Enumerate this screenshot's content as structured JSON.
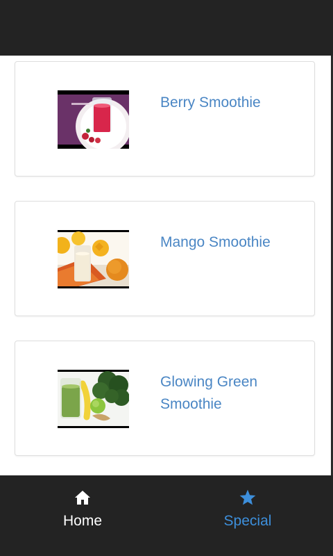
{
  "colors": {
    "bar_background": "#232323",
    "link_blue": "#4a86c4",
    "active_tab": "#3d8fdb",
    "inactive_tab": "#ffffff"
  },
  "list": {
    "items": [
      {
        "title": "Berry Smoothie",
        "thumbnail": "berry-smoothie-photo"
      },
      {
        "title": "Mango Smoothie",
        "thumbnail": "mango-smoothie-photo"
      },
      {
        "title": "Glowing Green Smoothie",
        "thumbnail": "green-smoothie-photo"
      }
    ]
  },
  "bottom_nav": {
    "tabs": [
      {
        "label": "Home",
        "icon": "home-icon",
        "active": false
      },
      {
        "label": "Special",
        "icon": "star-icon",
        "active": true
      }
    ]
  }
}
